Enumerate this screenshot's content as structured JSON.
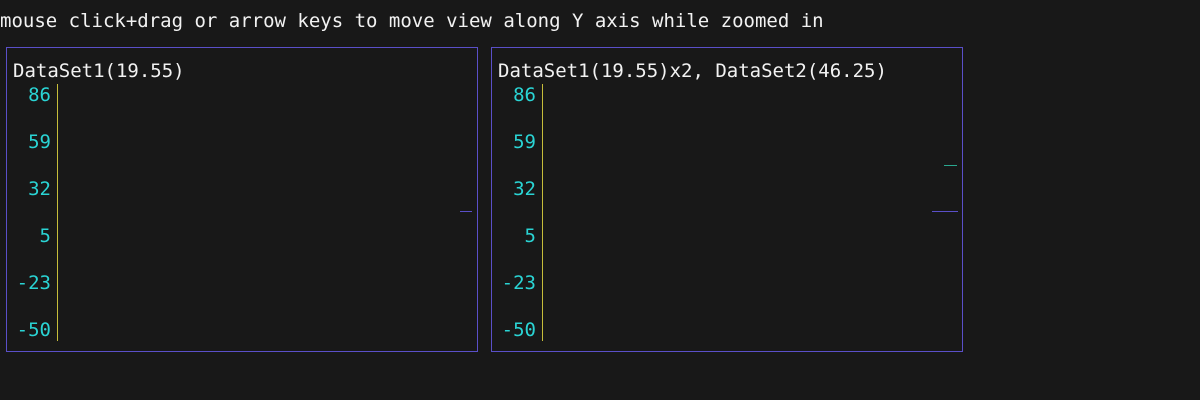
{
  "help_text": "mouse click+drag or arrow keys to move view along Y axis while zoomed in",
  "colors": {
    "background": "#181818",
    "panel_border": "#5a4fc8",
    "tick_labels": "#2ad4d4",
    "axis": "#c6bd3a",
    "dataset1": "#5a4fc8",
    "dataset2": "#2aa88f"
  },
  "chart_data": [
    {
      "type": "line",
      "title": "DataSet1(19.55)",
      "y_ticks": [
        "86",
        "59",
        "32",
        "5",
        "-23",
        "-50"
      ],
      "ylim": [
        -50,
        86
      ],
      "series": [
        {
          "name": "DataSet1",
          "values": [
            19.55
          ]
        }
      ]
    },
    {
      "type": "line",
      "title": "DataSet1(19.55)x2, DataSet2(46.25)",
      "y_ticks": [
        "86",
        "59",
        "32",
        "5",
        "-23",
        "-50"
      ],
      "ylim": [
        -50,
        86
      ],
      "series": [
        {
          "name": "DataSet1",
          "values": [
            19.55
          ]
        },
        {
          "name": "DataSet2",
          "values": [
            46.25
          ]
        }
      ]
    }
  ]
}
